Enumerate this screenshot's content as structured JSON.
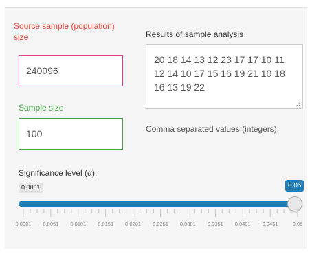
{
  "form": {
    "source_label": "Source sample (population) size",
    "source_value": "240096",
    "results_label": "Results of sample analysis",
    "results_value": "20 18 14 13 12 23 17 17 10 11 12 14 10 17 15 16 19 21 10 18 16 13 19 22",
    "sample_size_label": "Sample size",
    "sample_size_value": "100",
    "help_text": "Comma separated values (integers).",
    "significance_label": "Significance level (α):"
  },
  "slider": {
    "min_label": "0.0001",
    "value_label": "0.05",
    "value": 0.05,
    "min": 0.0001,
    "max": 0.05,
    "tick_labels": [
      "0.0001",
      "0.0051",
      "0.0101",
      "0.0151",
      "0.0201",
      "0.0251",
      "0.0301",
      "0.0351",
      "0.0401",
      "0.0451",
      "0.05"
    ]
  },
  "colors": {
    "accent": "#1f7db6",
    "source_label": "#e8433a",
    "sample_label": "#4aa34a",
    "source_border": "#e03e8c",
    "sample_border": "#4aa34a"
  }
}
